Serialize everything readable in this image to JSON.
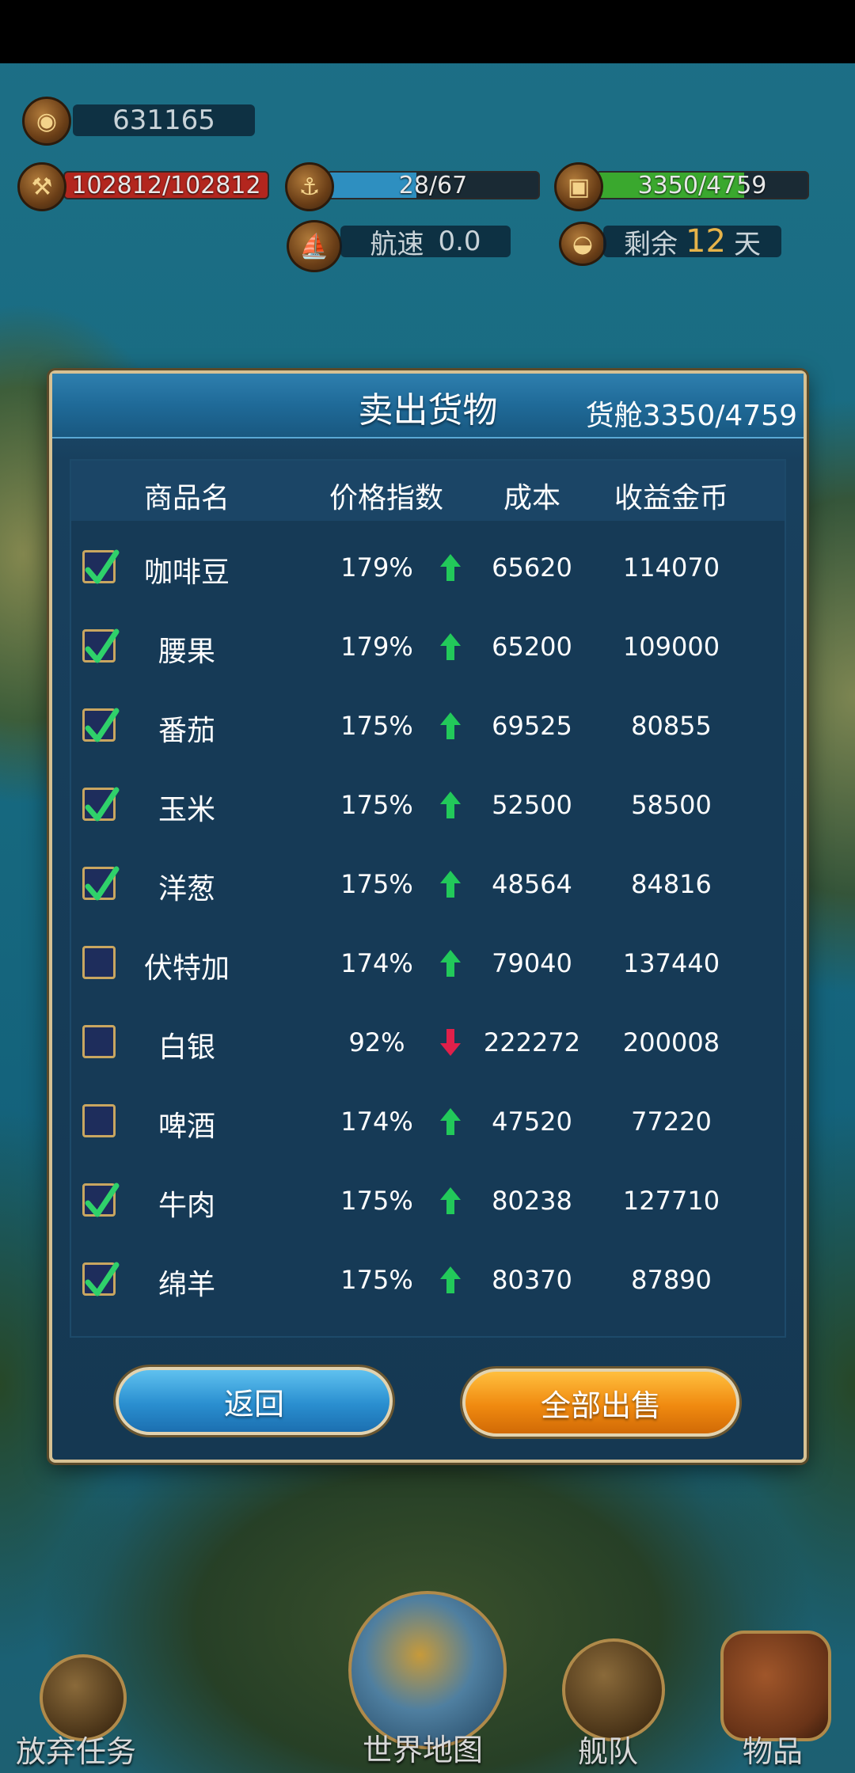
{
  "hud": {
    "gold": "631165",
    "durability": "102812/102812",
    "crew": "28/67",
    "cargo": "3350/4759",
    "speed_label": "航速",
    "speed_value": "0.0",
    "remaining_label": "剩余",
    "remaining_days": "12",
    "days_unit": "天",
    "durability_fill": 1.0,
    "crew_fill": 0.42,
    "cargo_fill": 0.7
  },
  "dialog": {
    "title": "卖出货物",
    "capacity": "货舱3350/4759",
    "columns": [
      "商品名",
      "价格指数",
      "成本",
      "收益金币"
    ],
    "rows": [
      {
        "checked": true,
        "name": "咖啡豆",
        "index": "179%",
        "trend": "up",
        "cost": "65620",
        "profit": "114070"
      },
      {
        "checked": true,
        "name": "腰果",
        "index": "179%",
        "trend": "up",
        "cost": "65200",
        "profit": "109000"
      },
      {
        "checked": true,
        "name": "番茄",
        "index": "175%",
        "trend": "up",
        "cost": "69525",
        "profit": "80855"
      },
      {
        "checked": true,
        "name": "玉米",
        "index": "175%",
        "trend": "up",
        "cost": "52500",
        "profit": "58500"
      },
      {
        "checked": true,
        "name": "洋葱",
        "index": "175%",
        "trend": "up",
        "cost": "48564",
        "profit": "84816"
      },
      {
        "checked": false,
        "name": "伏特加",
        "index": "174%",
        "trend": "up",
        "cost": "79040",
        "profit": "137440"
      },
      {
        "checked": false,
        "name": "白银",
        "index": "92%",
        "trend": "down",
        "cost": "222272",
        "profit": "200008"
      },
      {
        "checked": false,
        "name": "啤酒",
        "index": "174%",
        "trend": "up",
        "cost": "47520",
        "profit": "77220"
      },
      {
        "checked": true,
        "name": "牛肉",
        "index": "175%",
        "trend": "up",
        "cost": "80238",
        "profit": "127710"
      },
      {
        "checked": true,
        "name": "绵羊",
        "index": "175%",
        "trend": "up",
        "cost": "80370",
        "profit": "87890"
      }
    ],
    "back_label": "返回",
    "sell_all_label": "全部出售"
  },
  "nav": {
    "abandon": "放弃任务",
    "world_map": "世界地图",
    "fleet": "舰队",
    "items": "物品"
  },
  "colors": {
    "up_arrow": "#22c95a",
    "down_arrow": "#e0204a",
    "check": "#2fd16a",
    "durability_bar": "#b3261e",
    "crew_bar": "#2e8fc0",
    "cargo_bar": "#3aa82e"
  }
}
